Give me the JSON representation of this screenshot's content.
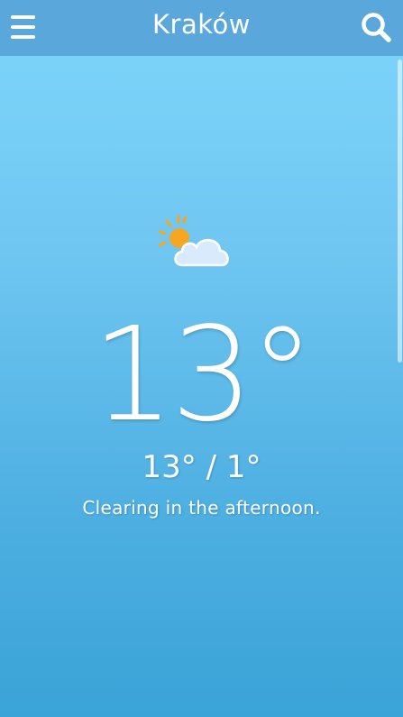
{
  "header": {
    "city": "Kraków",
    "menu_icon": "hamburger-menu-icon",
    "search_icon": "search-icon"
  },
  "weather": {
    "icon": "partly-sunny-cloud-icon",
    "current_temp": "13°",
    "range": "13° / 1°",
    "summary": "Clearing in the afternoon."
  },
  "colors": {
    "topbar": "#5aa7db",
    "sky_top": "#7fd6fb",
    "sky_bottom": "#3aa3d7",
    "sun": "#f5a623",
    "cloud": "#d8eafc"
  }
}
